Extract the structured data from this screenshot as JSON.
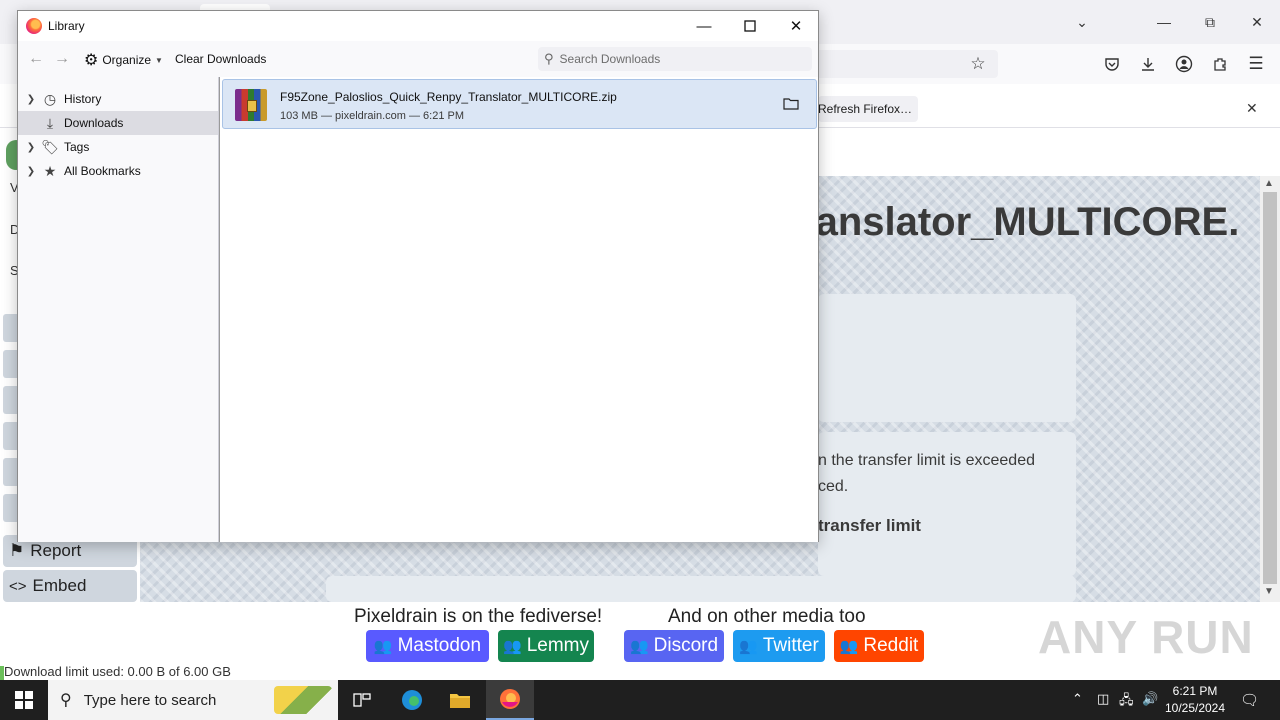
{
  "library": {
    "title": "Library",
    "toolbar": {
      "organize_label": "Organize",
      "clear_downloads_label": "Clear Downloads",
      "search_placeholder": "Search Downloads"
    },
    "tree": [
      {
        "label": "History",
        "icon": "clock-icon",
        "selected": false
      },
      {
        "label": "Downloads",
        "icon": "download-icon",
        "selected": true
      },
      {
        "label": "Tags",
        "icon": "tag-icon",
        "selected": false
      },
      {
        "label": "All Bookmarks",
        "icon": "star-icon",
        "selected": false
      }
    ],
    "downloads": [
      {
        "filename": "F95Zone_Paloslios_Quick_Renpy_Translator_MULTICORE.zip",
        "meta": "103 MB — pixeldrain.com — 6:21 PM"
      }
    ]
  },
  "browser": {
    "notification": {
      "refresh_label": "Refresh Firefox…"
    }
  },
  "page": {
    "title_fragment": "ranslator_MULTICORE.",
    "transfer_text_1": "n the transfer limit is exceeded",
    "transfer_text_2": "ced.",
    "transfer_bold": "transfer limit",
    "side_buttons": {
      "report": "Report",
      "embed": "Embed"
    },
    "fediverse_label": "Pixeldrain is on the fediverse!",
    "other_media_label": "And on other media too",
    "social": [
      {
        "label": "Mastodon",
        "color": "#595aff"
      },
      {
        "label": "Lemmy",
        "color": "#14854f"
      },
      {
        "label": "Discord",
        "color": "#5865f2"
      },
      {
        "label": "Twitter",
        "color": "#1d9bf0"
      },
      {
        "label": "Reddit",
        "color": "#ff4500"
      }
    ],
    "download_limit": "Download limit used: 0.00 B of 6.00 GB",
    "side_letters": [
      "V",
      "D",
      "S"
    ]
  },
  "watermark": "ANY RUN",
  "taskbar": {
    "search_placeholder": "Type here to search",
    "time": "6:21 PM",
    "date": "10/25/2024"
  }
}
